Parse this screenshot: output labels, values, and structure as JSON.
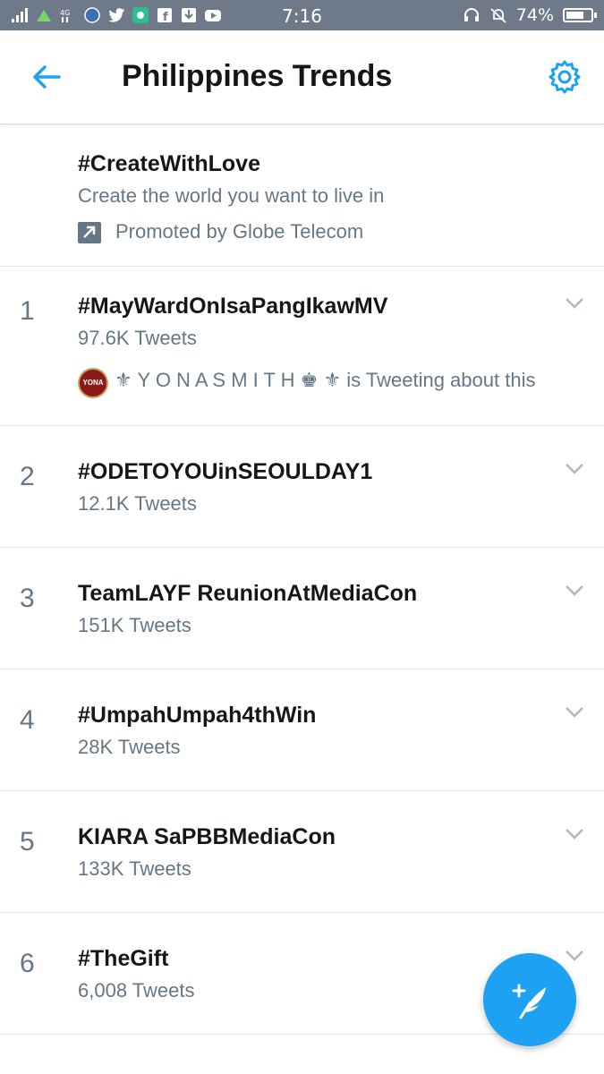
{
  "status_bar": {
    "time": "7:16",
    "battery": "74%",
    "battery_level": 0.74,
    "icons": [
      "signal-icon",
      "4g-icon",
      "app-icon",
      "twitter-icon",
      "app-icon",
      "facebook-icon",
      "download-icon",
      "youtube-icon",
      "headset-icon",
      "mute-icon",
      "battery-icon"
    ]
  },
  "header": {
    "title": "Philippines Trends",
    "back_icon": "back-arrow-icon",
    "settings_icon": "gear-icon"
  },
  "colors": {
    "accent": "#1da1f2",
    "muted_text": "#657786",
    "statusbar": "#6e7a89"
  },
  "promoted": {
    "name": "#CreateWithLove",
    "description": "Create the world you want to live in",
    "promoted_by": "Promoted by Globe Telecom"
  },
  "trends": [
    {
      "rank": "1",
      "name": "#MayWardOnIsaPangIkawMV",
      "count": "97.6K Tweets",
      "avatar_text": "YONA",
      "context": "⚜ Y O N A S M I T H ♚ ⚜ is Tweeting about this"
    },
    {
      "rank": "2",
      "name": "#ODETOYOUinSEOULDAY1",
      "count": "12.1K Tweets"
    },
    {
      "rank": "3",
      "name": "TeamLAYF ReunionAtMediaCon",
      "count": "151K Tweets"
    },
    {
      "rank": "4",
      "name": "#UmpahUmpah4thWin",
      "count": "28K Tweets"
    },
    {
      "rank": "5",
      "name": "KIARA SaPBBMediaCon",
      "count": "133K Tweets"
    },
    {
      "rank": "6",
      "name": "#TheGift",
      "count": "6,008 Tweets"
    }
  ],
  "fab_icon": "compose-tweet-icon"
}
